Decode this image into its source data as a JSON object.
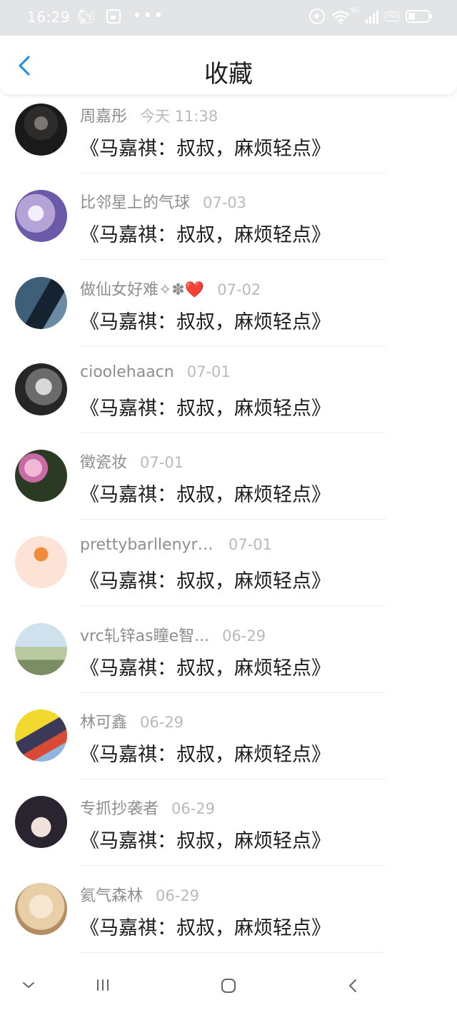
{
  "status_bar": {
    "time": "16:29",
    "network_label": "5G",
    "hd_label": "HD",
    "left_icons": [
      "uc-browser-icon",
      "calendar-icon",
      "more-dots-icon"
    ],
    "right_icons": [
      "target-icon",
      "wifi-icon",
      "signal-icon",
      "hd-icon",
      "battery-icon"
    ]
  },
  "header": {
    "title": "收藏",
    "back_icon": "chevron-left-icon",
    "accent_color": "#2b8fe8"
  },
  "favorites": [
    {
      "name": "周嘉彤",
      "time": "今天 11:38",
      "content": "《马嘉祺：叔叔，麻烦轻点》"
    },
    {
      "name": "比邻星上的气球",
      "time": "07-03",
      "content": "《马嘉祺：叔叔，麻烦轻点》"
    },
    {
      "name": "做仙女好难✧✽❤️",
      "time": "07-02",
      "content": "《马嘉祺：叔叔，麻烦轻点》"
    },
    {
      "name": "cioolehaacn",
      "time": "07-01",
      "content": "《马嘉祺：叔叔，麻烦轻点》"
    },
    {
      "name": "徵瓷妆",
      "time": "07-01",
      "content": "《马嘉祺：叔叔，麻烦轻点》"
    },
    {
      "name": "prettybarllenyrin...",
      "time": "07-01",
      "content": "《马嘉祺：叔叔，麻烦轻点》"
    },
    {
      "name": "vrc轧锌as瞳e智...",
      "time": "06-29",
      "content": "《马嘉祺：叔叔，麻烦轻点》"
    },
    {
      "name": "林可鑫",
      "time": "06-29",
      "content": "《马嘉祺：叔叔，麻烦轻点》"
    },
    {
      "name": "专抓抄袭者",
      "time": "06-29",
      "content": "《马嘉祺：叔叔，麻烦轻点》"
    },
    {
      "name": "氦气森林",
      "time": "06-29",
      "content": "《马嘉祺：叔叔，麻烦轻点》"
    }
  ],
  "nav_bar": {
    "icons": [
      "chevron-down-icon",
      "recents-icon",
      "home-icon",
      "back-icon"
    ]
  }
}
